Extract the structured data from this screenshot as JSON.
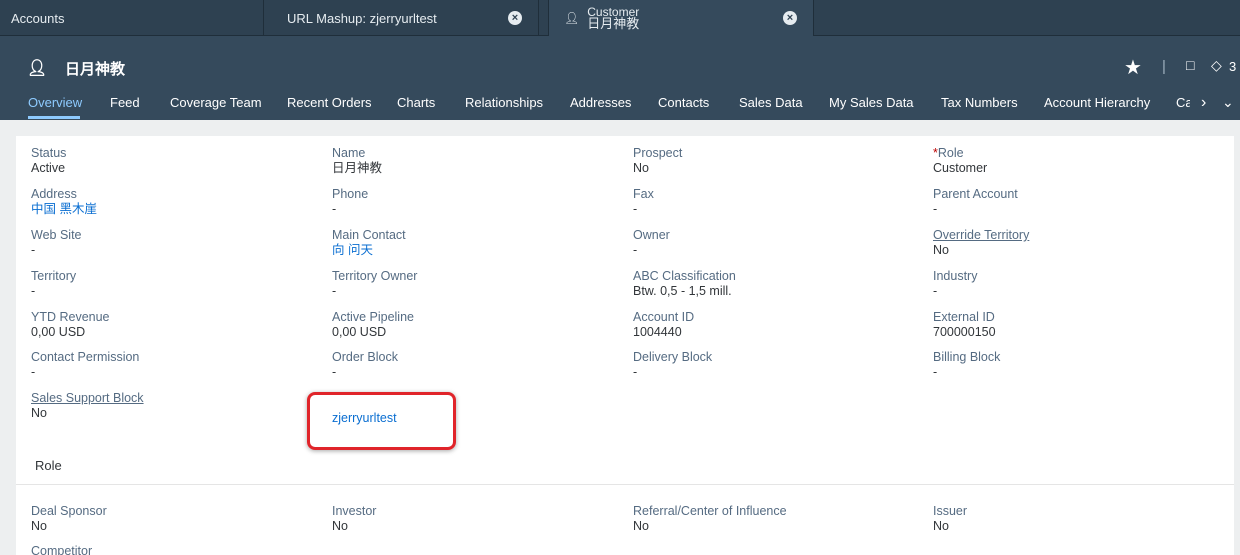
{
  "tabs": [
    {
      "label": "Accounts"
    },
    {
      "label": "URL Mashup: zjerryurltest",
      "close": "×"
    },
    {
      "label_line1": "Customer",
      "label_line2": "日月神教",
      "close": "×"
    }
  ],
  "header": {
    "title": "日月神教",
    "tag_count": "3"
  },
  "nav": [
    "Overview",
    "Feed",
    "Coverage Team",
    "Recent Orders",
    "Charts",
    "Relationships",
    "Addresses",
    "Contacts",
    "Sales Data",
    "My Sales Data",
    "Tax Numbers",
    "Account Hierarchy",
    "Ca"
  ],
  "fields": {
    "status": {
      "label": "Status",
      "value": "Active"
    },
    "name": {
      "label": "Name",
      "value": "日月神教"
    },
    "prospect": {
      "label": "Prospect",
      "value": "No"
    },
    "role": {
      "req": "*",
      "label": "Role",
      "value": "Customer"
    },
    "address": {
      "label": "Address",
      "value": "中国 黑木崖"
    },
    "phone": {
      "label": "Phone",
      "value": "-"
    },
    "fax": {
      "label": "Fax",
      "value": "-"
    },
    "parent_account": {
      "label": "Parent Account",
      "value": "-"
    },
    "web_site": {
      "label": "Web Site",
      "value": "-"
    },
    "main_contact": {
      "label": "Main Contact",
      "value": "向 问天"
    },
    "owner": {
      "label": "Owner",
      "value": "-"
    },
    "override_territory": {
      "label": "Override Territory",
      "value": "No"
    },
    "territory": {
      "label": "Territory",
      "value": "-"
    },
    "territory_owner": {
      "label": "Territory Owner",
      "value": "-"
    },
    "abc_classification": {
      "label": "ABC Classification",
      "value": "Btw. 0,5 - 1,5 mill."
    },
    "industry": {
      "label": "Industry",
      "value": "-"
    },
    "ytd_revenue": {
      "label": "YTD Revenue",
      "value": "0,00  USD"
    },
    "active_pipeline": {
      "label": "Active Pipeline",
      "value": "0,00  USD"
    },
    "account_id": {
      "label": "Account ID",
      "value": "1004440"
    },
    "external_id": {
      "label": "External ID",
      "value": "700000150"
    },
    "contact_permission": {
      "label": "Contact Permission",
      "value": "-"
    },
    "order_block": {
      "label": "Order Block",
      "value": "-"
    },
    "delivery_block": {
      "label": "Delivery Block",
      "value": "-"
    },
    "billing_block": {
      "label": "Billing Block",
      "value": "-"
    },
    "sales_support_block": {
      "label": "Sales Support Block",
      "value": "No"
    },
    "deal_sponsor": {
      "label": "Deal Sponsor",
      "value": "No"
    },
    "investor": {
      "label": "Investor",
      "value": "No"
    },
    "referral": {
      "label": "Referral/Center of Influence",
      "value": "No"
    },
    "issuer": {
      "label": "Issuer",
      "value": "No"
    },
    "competitor": {
      "label": "Competitor"
    }
  },
  "mashup_link": "zjerryurltest",
  "role_section_title": "Role",
  "colors": {
    "shell": "#354a5c",
    "tabstrip": "#2e4151",
    "link": "#0a6ed1",
    "active_tab": "#8ecbff",
    "highlight": "#e0242a"
  }
}
